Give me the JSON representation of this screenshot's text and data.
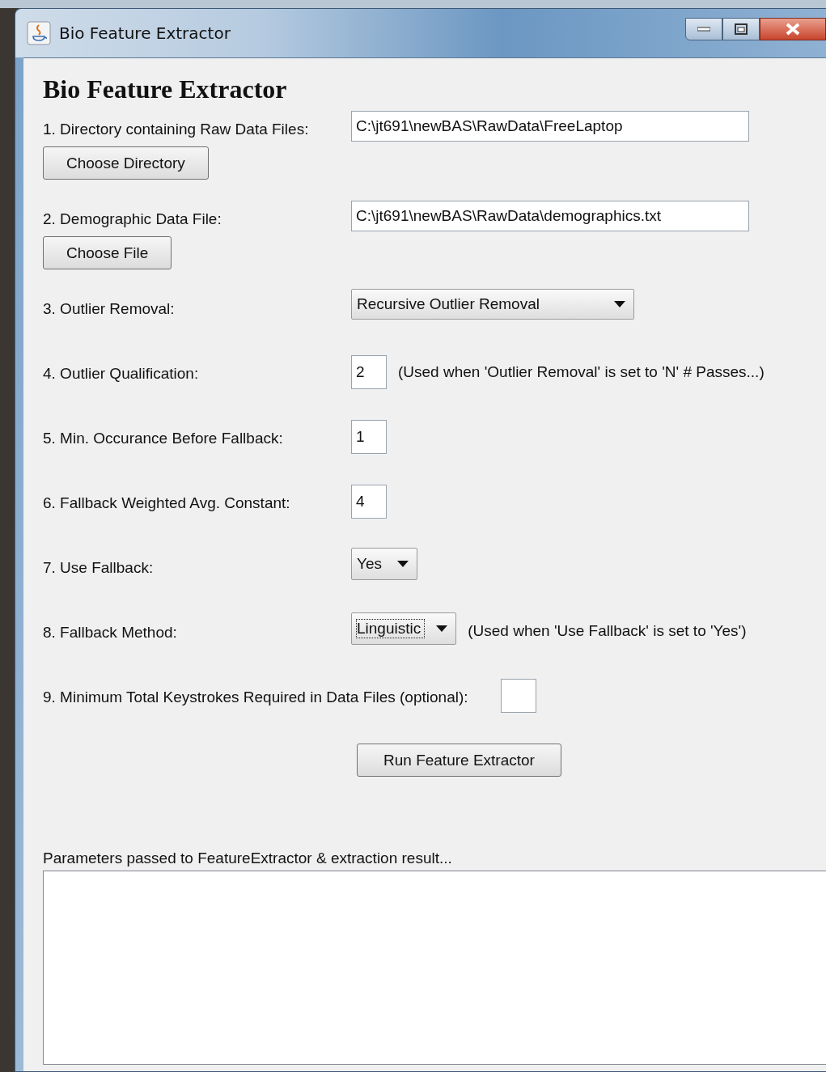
{
  "window": {
    "title": "Bio Feature Extractor"
  },
  "heading": "Bio Feature Extractor",
  "rows": [
    {
      "kind": "path",
      "label": "1. Directory containing Raw Data Files:",
      "value": "C:\\jt691\\newBAS\\RawData\\FreeLaptop",
      "button": "Choose Directory"
    },
    {
      "kind": "path",
      "label": "2. Demographic Data File:",
      "value": "C:\\jt691\\newBAS\\RawData\\demographics.txt",
      "button": "Choose File"
    },
    {
      "kind": "combo",
      "label": "3. Outlier Removal:",
      "value": "Recursive Outlier Removal",
      "focused": false
    },
    {
      "kind": "number",
      "label": "4. Outlier Qualification:",
      "value": "2",
      "note": "(Used when 'Outlier Removal' is set to 'N' # Passes...)"
    },
    {
      "kind": "number",
      "label": "5. Min. Occurance Before Fallback:",
      "value": "1"
    },
    {
      "kind": "number",
      "label": "6. Fallback Weighted Avg. Constant:",
      "value": "4"
    },
    {
      "kind": "combo",
      "label": "7. Use Fallback:",
      "value": "Yes",
      "focused": false
    },
    {
      "kind": "combo",
      "label": "8. Fallback Method:",
      "value": "Linguistic",
      "focused": true,
      "note": "(Used when 'Use Fallback' is set to 'Yes')"
    },
    {
      "kind": "inline",
      "label": "9. Minimum Total Keystrokes Required in Data Files (optional):"
    }
  ],
  "run_button": "Run Feature Extractor",
  "output": {
    "label": "Parameters passed to FeatureExtractor & extraction result..."
  }
}
